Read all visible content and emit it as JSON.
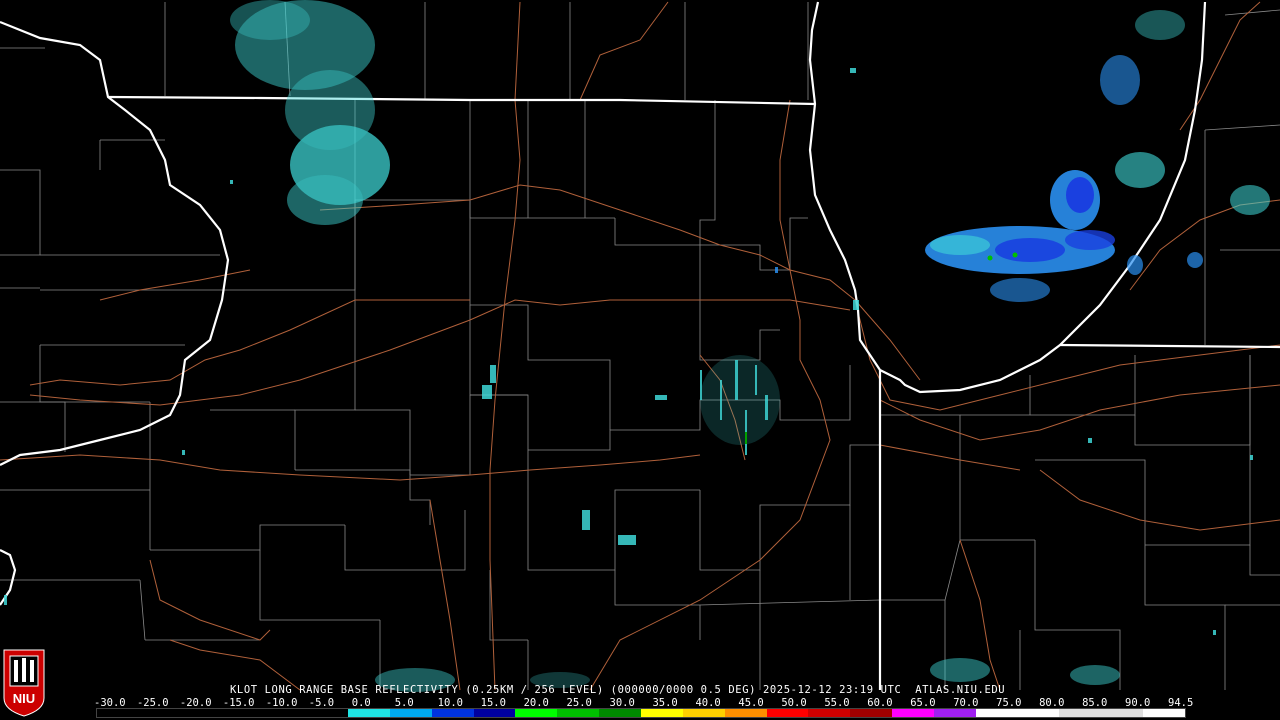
{
  "product": {
    "caption": "KLOT LONG RANGE BASE REFLECTIVITY (0.25KM / 256 LEVEL) (000000/0000 0.5 DEG) 2025-12-12 23:19 UTC  ATLAS.NIU.EDU",
    "station": "KLOT",
    "timestamp": "2025-12-12 23:19 UTC",
    "source": "ATLAS.NIU.EDU"
  },
  "logo": {
    "text": "NIU",
    "color_primary": "#cc0000",
    "color_secondary": "#ffffff"
  },
  "colorbar": {
    "labels": [
      "-30.0",
      "-25.0",
      "-20.0",
      "-15.0",
      "-10.0",
      "-5.0",
      "0.0",
      "5.0",
      "10.0",
      "15.0",
      "20.0",
      "25.0",
      "30.0",
      "35.0",
      "40.0",
      "45.0",
      "50.0",
      "55.0",
      "60.0",
      "65.0",
      "70.0",
      "75.0",
      "80.0",
      "85.0",
      "90.0",
      "94.5"
    ],
    "colors": [
      "#000000",
      "#000000",
      "#000000",
      "#000000",
      "#000000",
      "#000000",
      "#1fe3e3",
      "#00a9ef",
      "#0033e0",
      "#0000a0",
      "#00ff00",
      "#00c000",
      "#008a00",
      "#ffff00",
      "#ffd000",
      "#ff9000",
      "#ff0000",
      "#d00000",
      "#a00000",
      "#ff00ff",
      "#a020f0",
      "#ffffff",
      "#ffffff",
      "#e0e0e0",
      "#e0e0e0",
      "#ffffff"
    ]
  },
  "map_colors": {
    "background": "#000000",
    "state_border": "#ffffff",
    "county_border": "#8a8a8a",
    "highway": "#b0603a",
    "echo_light": "#3fd8d8",
    "echo_mid": "#2a8ff0",
    "echo_heavy": "#1a40e0"
  }
}
